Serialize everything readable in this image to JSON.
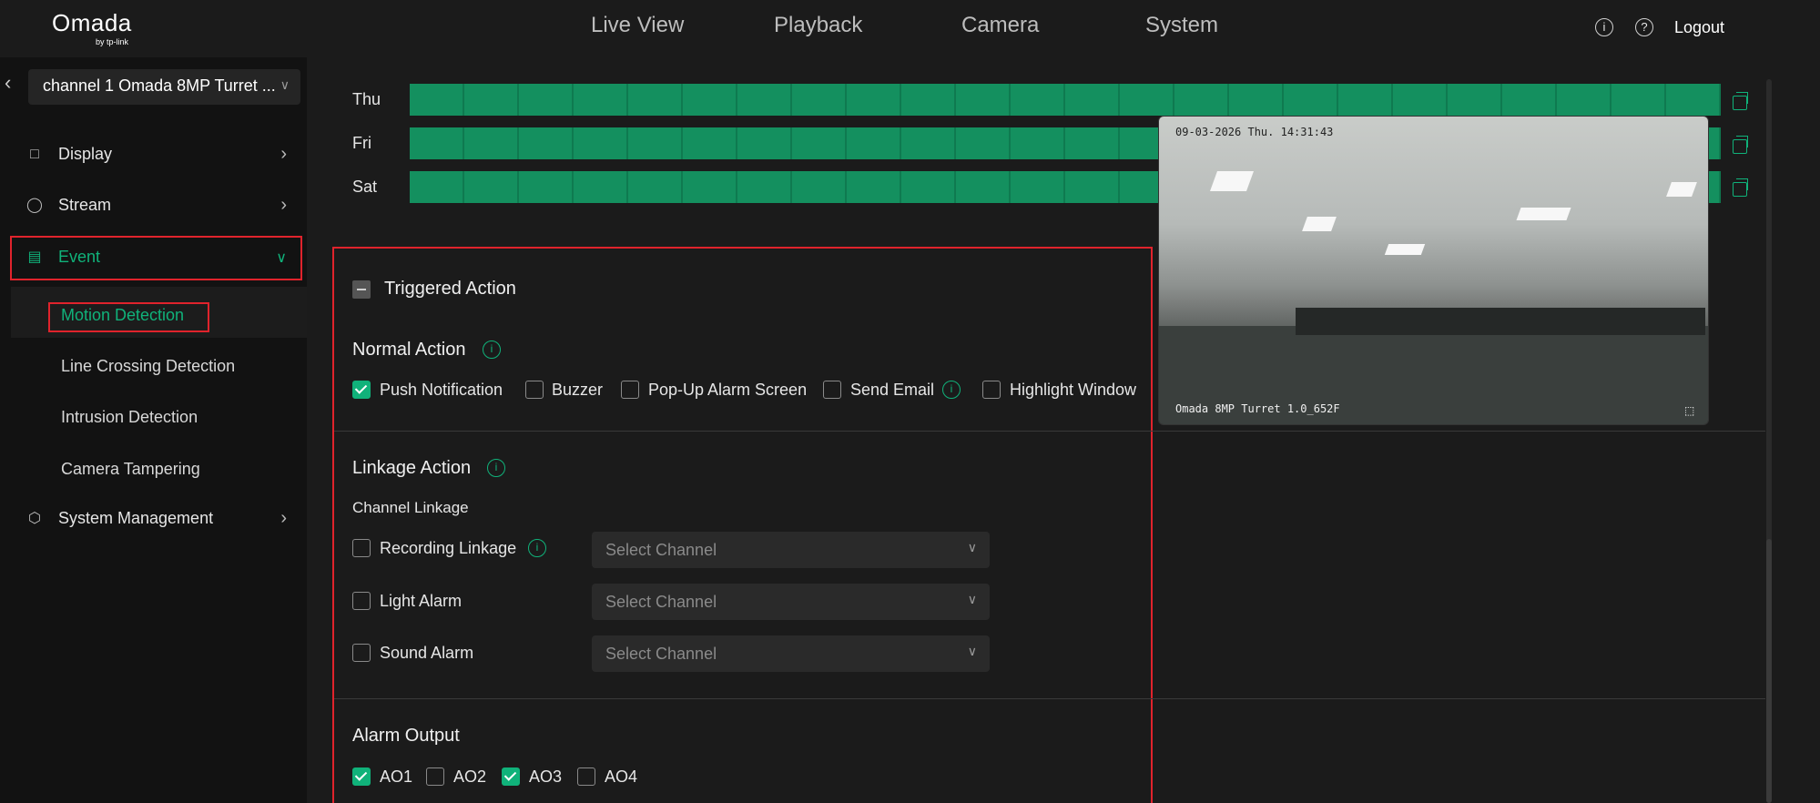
{
  "app": {
    "logo": "Omada",
    "logo_sub": "by tp-link"
  },
  "topnav": {
    "items": [
      "Live View",
      "Playback",
      "Camera",
      "System"
    ],
    "logout": "Logout"
  },
  "sidebar": {
    "channel": "channel 1 Omada 8MP Turret ...",
    "menu": [
      {
        "label": "Display",
        "icon": "monitor-icon"
      },
      {
        "label": "Stream",
        "icon": "stream-icon"
      },
      {
        "label": "Event",
        "icon": "event-icon"
      },
      {
        "label": "System Management",
        "icon": "gear-icon"
      }
    ],
    "event_sub": [
      "Motion Detection",
      "Line Crossing Detection",
      "Intrusion Detection",
      "Camera Tampering"
    ]
  },
  "schedule": {
    "days": [
      "Thu",
      "Fri",
      "Sat"
    ]
  },
  "camera": {
    "timestamp": "09-03-2026 Thu. 14:31:43",
    "name": "Omada 8MP Turret 1.0_652F"
  },
  "triggered": {
    "title": "Triggered Action",
    "normal_title": "Normal Action",
    "normal": [
      {
        "label": "Push Notification",
        "checked": true
      },
      {
        "label": "Buzzer",
        "checked": false
      },
      {
        "label": "Pop-Up Alarm Screen",
        "checked": false
      },
      {
        "label": "Send Email",
        "checked": false
      },
      {
        "label": "Highlight Window",
        "checked": false
      }
    ],
    "linkage_title": "Linkage Action",
    "channel_linkage": "Channel Linkage",
    "linkages": [
      {
        "label": "Recording Linkage",
        "placeholder": "Select Channel"
      },
      {
        "label": "Light Alarm",
        "placeholder": "Select Channel"
      },
      {
        "label": "Sound Alarm",
        "placeholder": "Select Channel"
      }
    ],
    "alarm_output_title": "Alarm Output",
    "alarm_outputs": [
      {
        "label": "AO1",
        "checked": true
      },
      {
        "label": "AO2",
        "checked": false
      },
      {
        "label": "AO3",
        "checked": true
      },
      {
        "label": "AO4",
        "checked": false
      }
    ]
  },
  "colors": {
    "accent": "#10b27a",
    "highlight_border": "#e0232c",
    "schedule_bar": "#14905f"
  }
}
